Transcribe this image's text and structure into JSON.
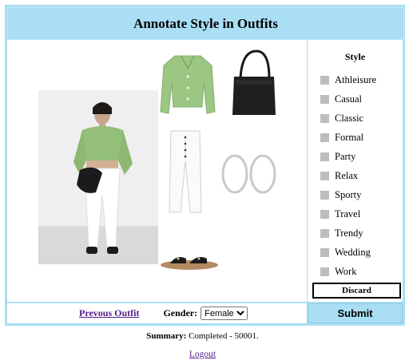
{
  "title": "Annotate Style in Outfits",
  "style_panel": {
    "heading": "Style",
    "options": [
      "Athleisure",
      "Casual",
      "Classic",
      "Formal",
      "Party",
      "Relax",
      "Sporty",
      "Travel",
      "Trendy",
      "Wedding",
      "Work"
    ],
    "discard_label": "Discard",
    "submit_label": "Submit"
  },
  "footer": {
    "prev_outfit": "Prevous Outfit",
    "gender_label": "Gender:",
    "gender_value": "Female",
    "summary_label": "Summary:",
    "summary_text": "Completed - 50001.",
    "logout": "Logout"
  }
}
